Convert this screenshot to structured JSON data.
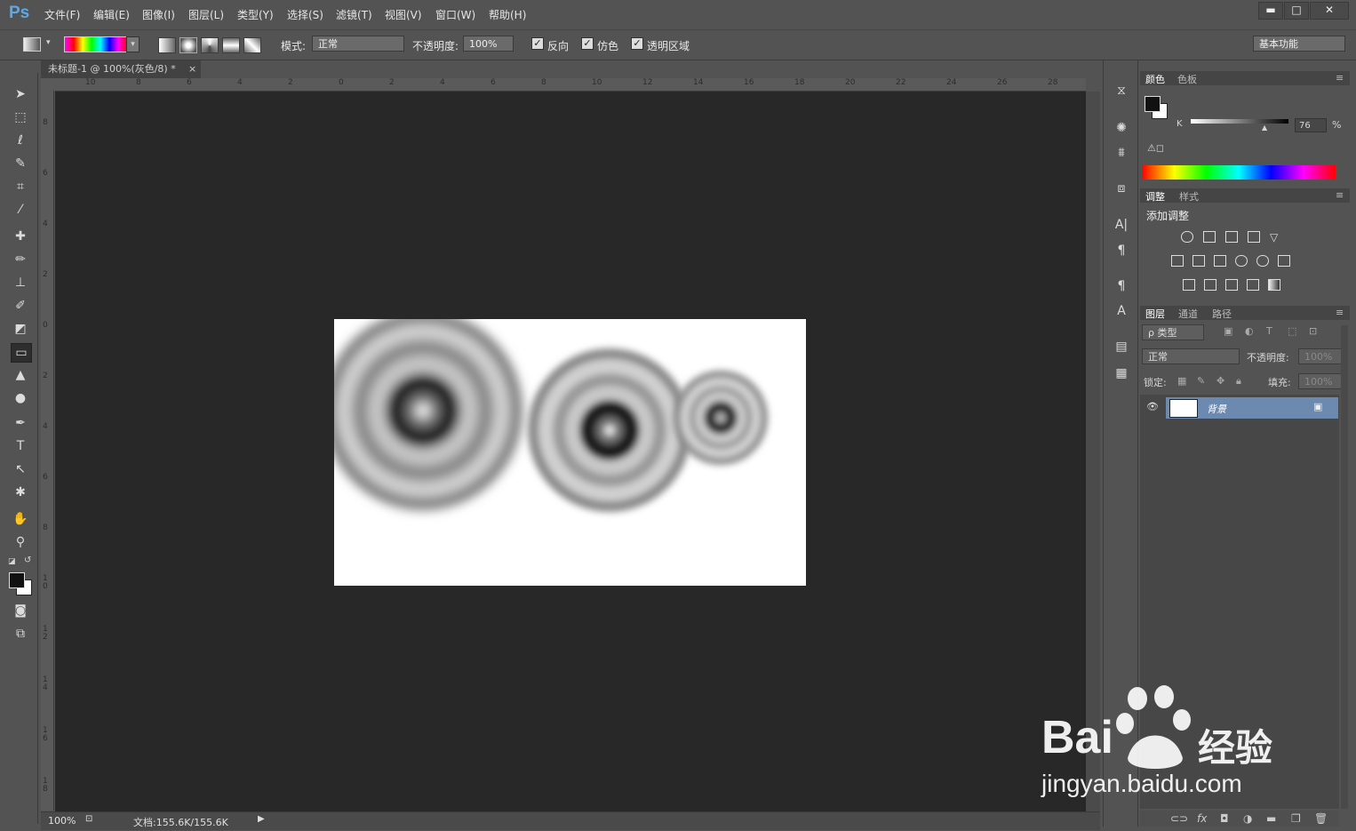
{
  "app": {
    "logo": "Ps"
  },
  "menu": [
    {
      "label": "文件(F)"
    },
    {
      "label": "编辑(E)"
    },
    {
      "label": "图像(I)"
    },
    {
      "label": "图层(L)"
    },
    {
      "label": "类型(Y)"
    },
    {
      "label": "选择(S)"
    },
    {
      "label": "滤镜(T)"
    },
    {
      "label": "视图(V)"
    },
    {
      "label": "窗口(W)"
    },
    {
      "label": "帮助(H)"
    }
  ],
  "window_buttons": {
    "minimize": "▬",
    "maximize": "□",
    "close": "✕"
  },
  "options": {
    "mode_label": "模式:",
    "mode_value": "正常",
    "opacity_label": "不透明度:",
    "opacity_value": "100%",
    "reverse_label": "反向",
    "dither_label": "仿色",
    "transparency_label": "透明区域",
    "workspace_value": "基本功能"
  },
  "document": {
    "tab_title": "未标题-1 @ 100%(灰色/8) *",
    "close": "×",
    "ruler_top": [
      "10",
      "8",
      "6",
      "4",
      "2",
      "0",
      "2",
      "4",
      "6",
      "8",
      "10",
      "12",
      "14",
      "16",
      "18",
      "20",
      "22",
      "24",
      "26",
      "28"
    ],
    "ruler_left": [
      "8",
      "6",
      "4",
      "2",
      "0",
      "2",
      "4",
      "6",
      "8",
      "10",
      "12",
      "14",
      "16",
      "18"
    ]
  },
  "status": {
    "zoom": "100%",
    "doc_info": "文档:155.6K/155.6K"
  },
  "color_panel": {
    "tab_color": "颜色",
    "tab_swatches": "色板",
    "channel_label": "K",
    "value": "76",
    "unit": "%"
  },
  "adjust_panel": {
    "tab_adjust": "调整",
    "tab_styles": "样式",
    "title": "添加调整"
  },
  "layers_panel": {
    "tab_layers": "图层",
    "tab_channels": "通道",
    "tab_paths": "路径",
    "filter_label": "ρ 类型",
    "blend_mode": "正常",
    "opacity_label": "不透明度:",
    "opacity_value": "100%",
    "lock_label": "锁定:",
    "fill_label": "填充:",
    "fill_value": "100%",
    "layer_name": "背景"
  },
  "watermark": {
    "brand": "Bai",
    "brand2": "经验",
    "url": "jingyan.baidu.com"
  }
}
